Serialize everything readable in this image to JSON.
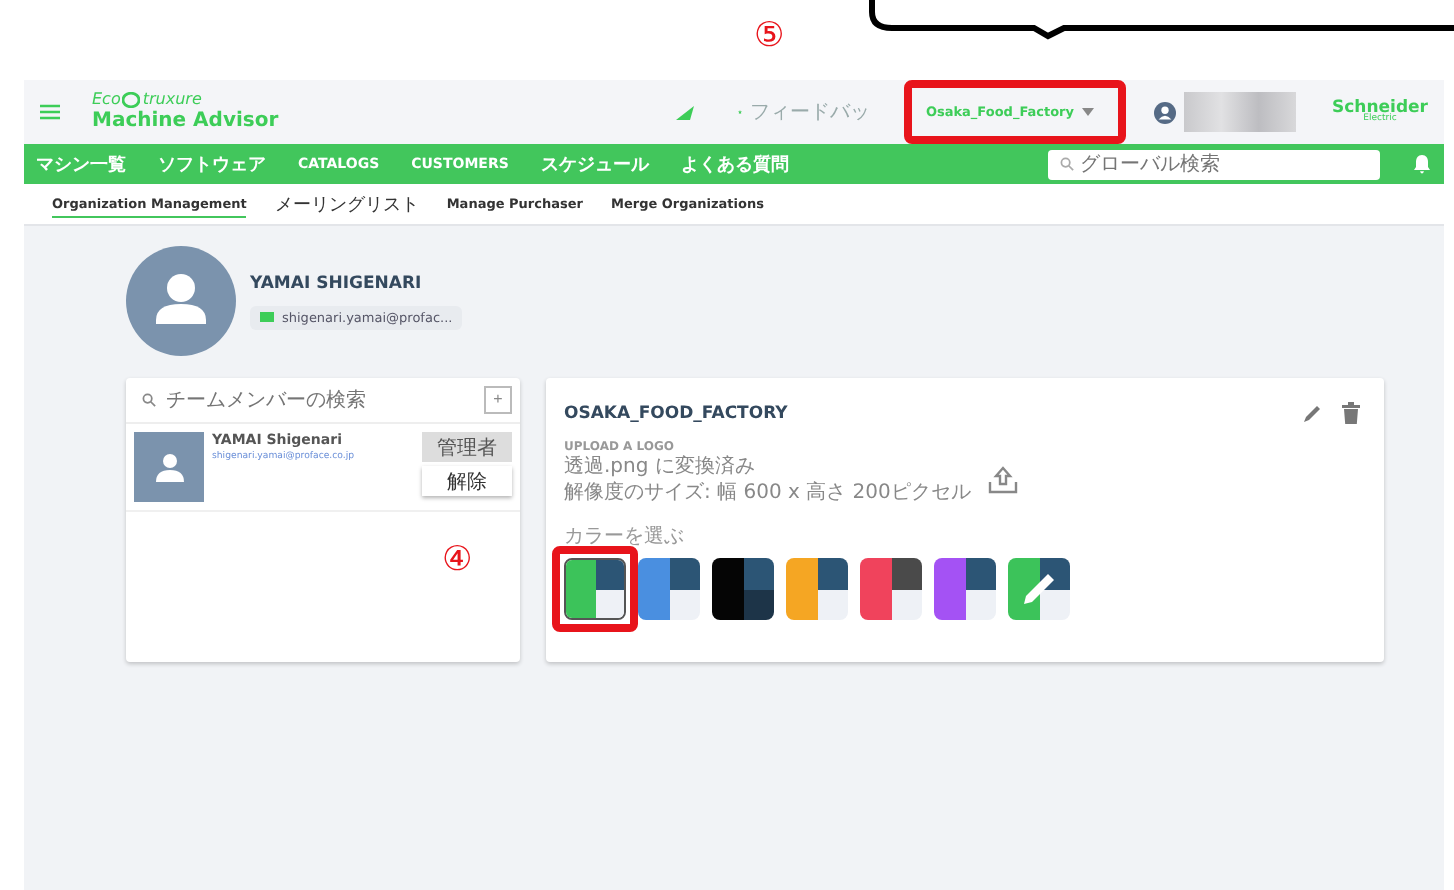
{
  "annotations": [
    {
      "kind": "step",
      "label": "⑤"
    },
    {
      "kind": "step",
      "label": "④"
    }
  ],
  "header": {
    "logo_prefix": "Eco",
    "logo_suffix": "truxure",
    "product": "Machine Advisor",
    "feedback": "フィードバッ",
    "organization": "Osaka_Food_Factory",
    "brand_top": "Schneider",
    "brand_bottom": "Electric"
  },
  "nav": {
    "items": [
      {
        "label": "マシン一覧"
      },
      {
        "label": "ソフトウェア"
      },
      {
        "label": "CATALOGS"
      },
      {
        "label": "CUSTOMERS"
      },
      {
        "label": "スケジュール"
      },
      {
        "label": "よくある質問"
      }
    ],
    "search": {
      "placeholder": "グローバル検索"
    }
  },
  "subnav": [
    {
      "label": "Organization Management",
      "selected": true
    },
    {
      "label": "メーリングリスト",
      "selected": false
    },
    {
      "label": "Manage Purchaser",
      "selected": false
    },
    {
      "label": "Merge Organizations",
      "selected": false
    }
  ],
  "profile": {
    "name": "YAMAI SHIGENARI",
    "email": "shigenari.yamai@profac..."
  },
  "members": {
    "search": {
      "placeholder": "チームメンバーの検索"
    },
    "add": "+",
    "rows": [
      {
        "name": "YAMAI Shigenari",
        "email": "shigenari.yamai@proface.co.jp",
        "role": "管理者",
        "remove": "解除"
      }
    ]
  },
  "organization": {
    "title": "OSAKA_FOOD_FACTORY",
    "upload_title": "UPLOAD A LOGO",
    "upload_lines": [
      "透過.png に変換済み",
      "解像度のサイズ: 幅 600 x 高さ 200ピクセル"
    ],
    "color_label": "カラーを選ぶ",
    "swatches": [
      {
        "kind": "light",
        "color": "#3cc35a",
        "selected": true
      },
      {
        "kind": "light",
        "color": "#4a8fe0",
        "selected": false
      },
      {
        "kind": "dark",
        "color": "#050505",
        "selected": false
      },
      {
        "kind": "light",
        "color": "#f5a623",
        "selected": false
      },
      {
        "kind": "grey",
        "color": "#f0435c",
        "selected": false
      },
      {
        "kind": "light",
        "color": "#a452f4",
        "selected": false
      },
      {
        "kind": "custom",
        "color": "#3cc35a",
        "selected": false
      }
    ]
  }
}
